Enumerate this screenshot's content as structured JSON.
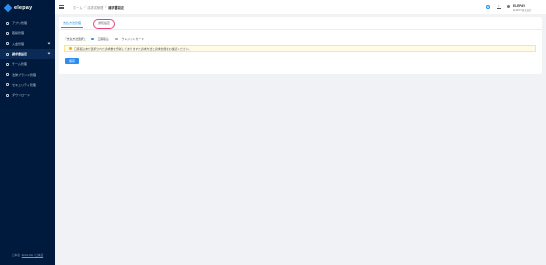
{
  "app": {
    "logo_text": "elepay"
  },
  "sidebar": {
    "items": [
      {
        "label": "アプリ管理",
        "icon": "app-icon"
      },
      {
        "label": "取締管理",
        "icon": "document-icon"
      },
      {
        "label": "入金管理",
        "icon": "wallet-icon"
      },
      {
        "label": "請求書設定",
        "icon": "invoice-icon"
      },
      {
        "label": "チーム管理",
        "icon": "team-icon"
      },
      {
        "label": "法律ブランド管理",
        "icon": "brand-icon"
      },
      {
        "label": "セキュリティ管理",
        "icon": "shield-icon"
      },
      {
        "label": "ダウンロード",
        "icon": "download-icon"
      }
    ],
    "footer": {
      "lang_prefix": "日本語",
      "lang_link": "ENGLISH / 日本語"
    }
  },
  "header": {
    "breadcrumb": [
      "ホーム",
      "請求書管理",
      "請求書設定"
    ],
    "user_name": "ELEPAY",
    "user_sub": "ELEPAY株式会社"
  },
  "tabs": [
    "支払方法管理",
    "通知設定"
  ],
  "payment_options": {
    "prefix": "「支払方法選択」：",
    "options": [
      {
        "label": "口座振込",
        "checked": true
      },
      {
        "label": "クレジットカード",
        "checked": false
      }
    ]
  },
  "notice": "口座振込未だ選択された請求書を登録してありますた請求方法と請求金額をお確認ください。",
  "save_label": "保存",
  "colors": {
    "accent": "#2d8cf0",
    "sidebar": "#001a3d",
    "highlight": "#e9457a"
  }
}
